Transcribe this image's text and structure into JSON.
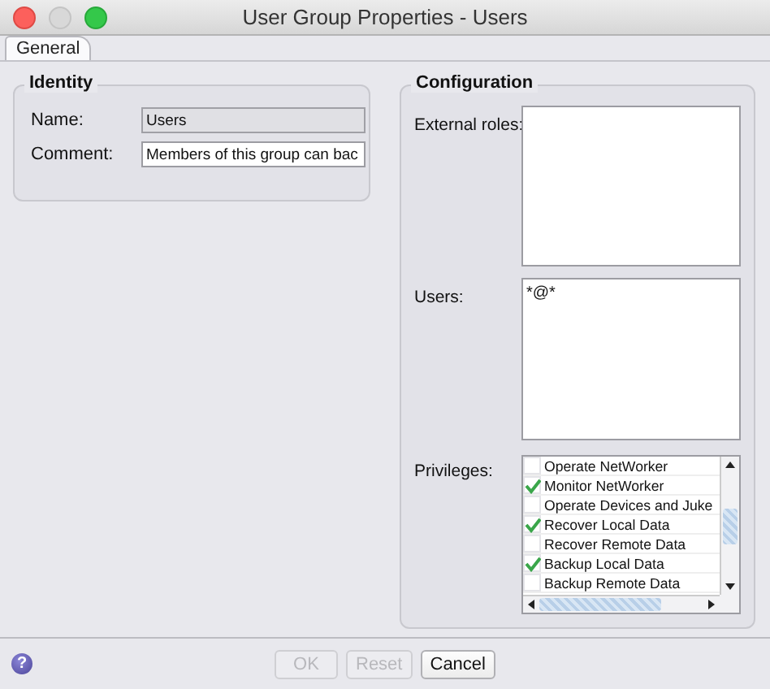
{
  "window": {
    "title": "User Group Properties - Users"
  },
  "tabs": [
    {
      "label": "General",
      "selected": true
    }
  ],
  "identity": {
    "title": "Identity",
    "fields": [
      {
        "label": "Name:",
        "value": "Users",
        "disabled": true
      },
      {
        "label": "Comment:",
        "value": "Members of this group can bac",
        "disabled": false
      }
    ]
  },
  "configuration": {
    "title": "Configuration",
    "external_roles": {
      "label": "External roles:"
    },
    "users": {
      "label": "Users:",
      "items": [
        "*@*"
      ]
    },
    "privileges": {
      "label": "Privileges:",
      "items": [
        {
          "label": "Operate NetWorker",
          "checked": false
        },
        {
          "label": "Monitor NetWorker",
          "checked": true
        },
        {
          "label": "Operate Devices and Juke",
          "checked": false
        },
        {
          "label": "Recover Local Data",
          "checked": true
        },
        {
          "label": "Recover Remote Data",
          "checked": false
        },
        {
          "label": "Backup Local Data",
          "checked": true
        },
        {
          "label": "Backup Remote Data",
          "checked": false
        }
      ]
    }
  },
  "help": "?",
  "buttons": [
    {
      "label": "OK",
      "disabled": true
    },
    {
      "label": "Reset",
      "disabled": true
    },
    {
      "label": "Cancel",
      "disabled": false
    }
  ]
}
